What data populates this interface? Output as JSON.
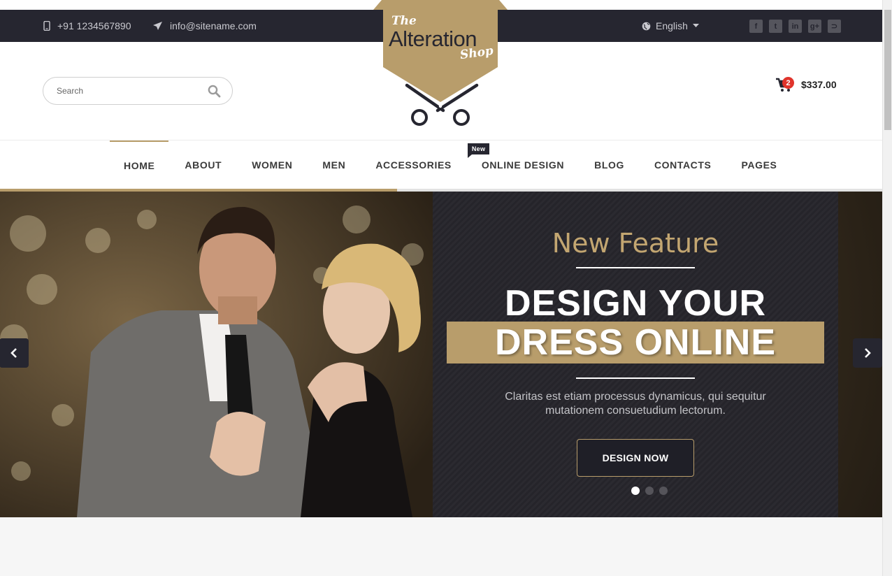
{
  "topbar": {
    "phone": "+91 1234567890",
    "email": "info@sitename.com",
    "language": "English",
    "social": [
      "facebook-icon",
      "twitter-icon",
      "linkedin-icon",
      "google-plus-icon",
      "rss-icon"
    ]
  },
  "logo": {
    "the": "The",
    "name": "Alteration",
    "shop": "Shop"
  },
  "search": {
    "placeholder": "Search"
  },
  "cart": {
    "count": "2",
    "total": "$337.00"
  },
  "nav": {
    "items": [
      "HOME",
      "ABOUT",
      "WOMEN",
      "MEN",
      "ACCESSORIES",
      "ONLINE DESIGN",
      "BLOG",
      "CONTACTS",
      "PAGES"
    ],
    "active": "HOME",
    "new_badge": "New"
  },
  "slider": {
    "progress": 0.45,
    "kicker": "New Feature",
    "headline_1": "DESIGN YOUR",
    "headline_2": "DRESS ONLINE",
    "description": "Claritas est etiam processus dynamicus, qui sequitur mutationem consuetudium lectorum.",
    "cta": "DESIGN NOW",
    "slides": 3,
    "current": 1
  },
  "colors": {
    "accent": "#b89d6b",
    "dark": "#262630",
    "badge": "#e0342c"
  }
}
